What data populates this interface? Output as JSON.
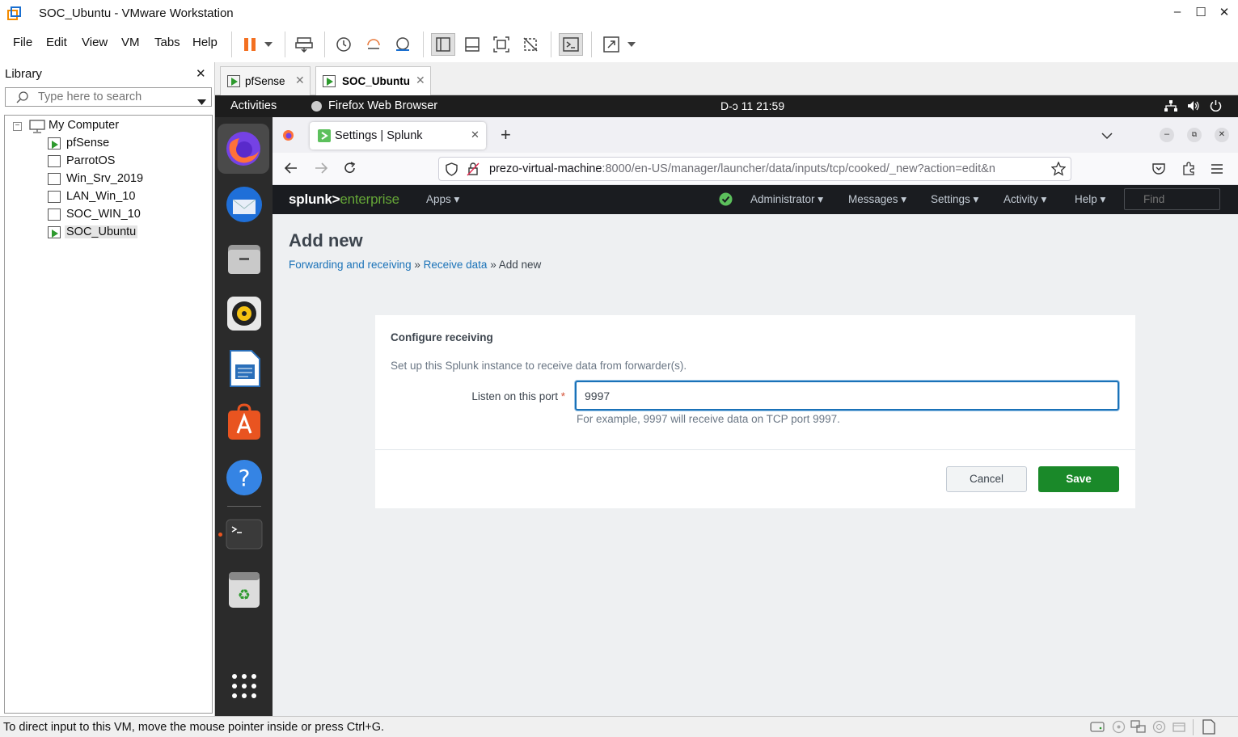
{
  "window": {
    "title": "SOC_Ubuntu - VMware Workstation",
    "minimize": "–",
    "maximize": "☐",
    "close": "✕"
  },
  "menu": [
    "File",
    "Edit",
    "View",
    "VM",
    "Tabs",
    "Help"
  ],
  "library": {
    "title": "Library",
    "close": "✕",
    "search_placeholder": "Type here to search",
    "root": "My Computer",
    "vms": [
      "pfSense",
      "ParrotOS",
      "Win_Srv_2019",
      "LAN_Win_10",
      "SOC_WIN_10",
      "SOC_Ubuntu"
    ]
  },
  "vm_tabs": [
    {
      "label": "pfSense"
    },
    {
      "label": "SOC_Ubuntu"
    }
  ],
  "gnome": {
    "activities": "Activities",
    "app": "Firefox Web Browser",
    "clock": "D-ɔ 11  21:59"
  },
  "firefox": {
    "tab_title": "Settings | Splunk",
    "url_host": "prezo-virtual-machine",
    "url_path": ":8000/en-US/manager/launcher/data/inputs/tcp/cooked/_new?action=edit&n"
  },
  "splunk": {
    "logo_a": "splunk>",
    "logo_b": "enterprise",
    "apps": "Apps ▾",
    "menus": [
      "Administrator ▾",
      "Messages ▾",
      "Settings ▾",
      "Activity ▾",
      "Help ▾"
    ],
    "find_placeholder": "Find",
    "page_title": "Add new",
    "breadcrumb": {
      "a": "Forwarding and receiving",
      "sep1": "»",
      "b": "Receive data",
      "sep2": "»",
      "c": "Add new"
    },
    "section_title": "Configure receiving",
    "description": "Set up this Splunk instance to receive data from forwarder(s).",
    "port_label": "Listen on this port",
    "required": "*",
    "port_value": "9997",
    "help": "For example, 9997 will receive data on TCP port 9997.",
    "cancel": "Cancel",
    "save": "Save"
  },
  "status": "To direct input to this VM, move the mouse pointer inside or press Ctrl+G.",
  "colors": {
    "splunk_green": "#5cc05c",
    "save_green": "#1a8929",
    "link_blue": "#1a72b8",
    "ubuntu_orange": "#e95420"
  }
}
